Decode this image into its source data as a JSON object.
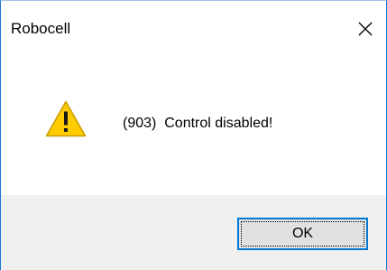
{
  "window": {
    "title": "Robocell"
  },
  "icons": {
    "close": "close-icon",
    "alert": "warning-icon"
  },
  "dialog": {
    "message": "(903)  Control disabled!",
    "ok_label": "OK"
  },
  "colors": {
    "window_border": "#1976d2",
    "footer_bg": "#f0f0f0",
    "button_bg": "#e1e1e1",
    "button_focus_border": "#0078d7",
    "warning_fill": "#ffcc00",
    "warning_outline": "#c99a00"
  }
}
